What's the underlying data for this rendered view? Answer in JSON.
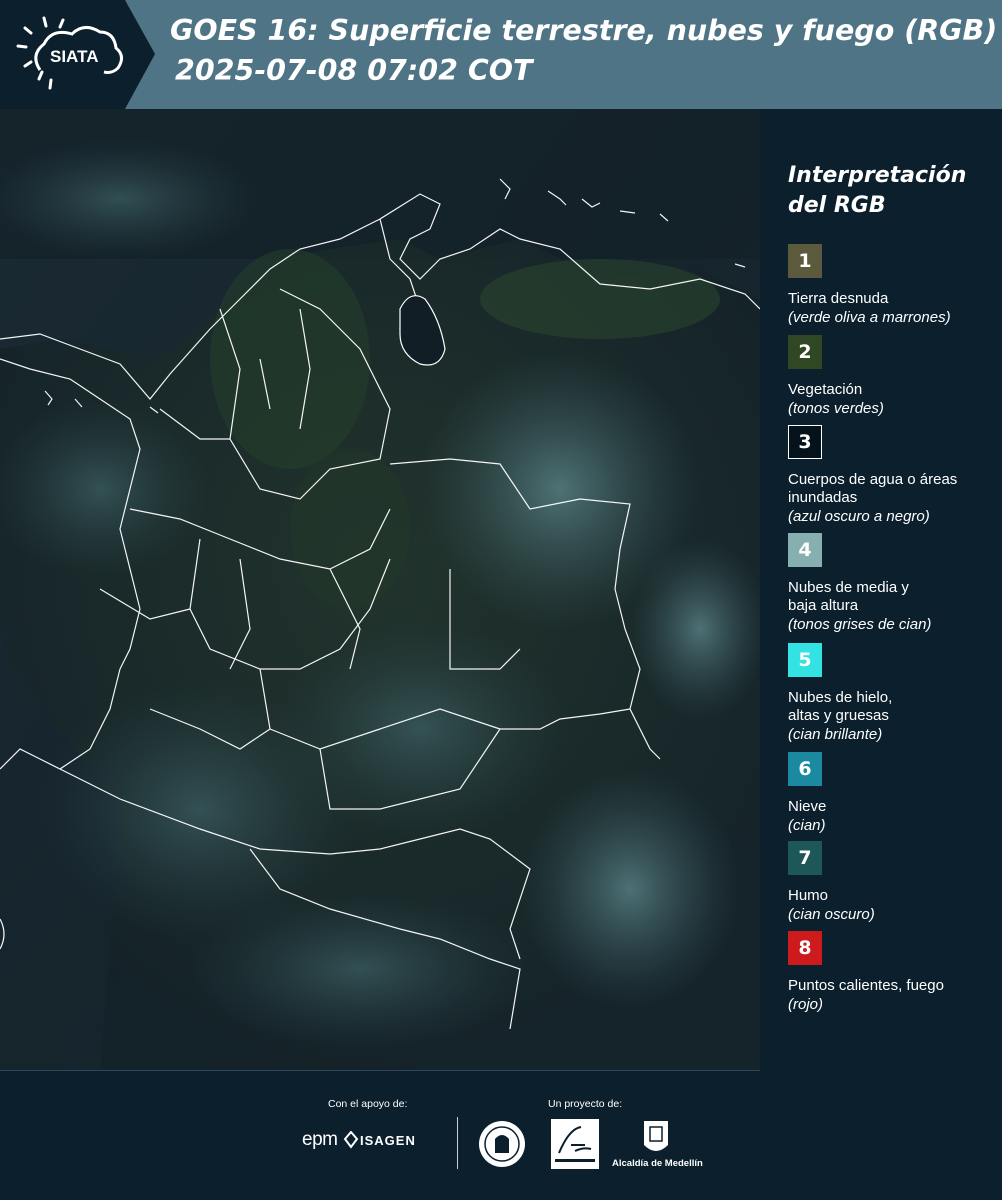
{
  "header": {
    "title_line1": "GOES 16: Superficie terrestre, nubes y fuego (RGB)",
    "title_line2": "2025-07-08 07:02 COT",
    "logo_text": "SIATA",
    "color": "#4f7485"
  },
  "legend": {
    "title_line1": "Interpretación",
    "title_line2": "del RGB",
    "items": [
      {
        "number": "1",
        "color": "#5b5a3c",
        "label": "Tierra desnuda",
        "sub": "(verde oliva a marrones)"
      },
      {
        "number": "2",
        "color": "#2f4722",
        "label": "Vegetación",
        "sub": "(tonos verdes)"
      },
      {
        "number": "3",
        "color": "#04121c",
        "label": "Cuerpos de agua o áreas inundadas",
        "sub": "(azul oscuro a negro)"
      },
      {
        "number": "4",
        "color": "#86b0b0",
        "label": "Nubes de media y baja altura",
        "sub": "(tonos grises de cian)"
      },
      {
        "number": "5",
        "color": "#33e2e2",
        "label": "Nubes de hielo, altas y gruesas",
        "sub": "(cian brillante)"
      },
      {
        "number": "6",
        "color": "#1b8aa0",
        "label": "Nieve",
        "sub": "(cian)"
      },
      {
        "number": "7",
        "color": "#1d5758",
        "label": "Humo",
        "sub": "(cian oscuro)"
      },
      {
        "number": "8",
        "color": "#cc1a1d",
        "label": "Puntos calientes, fuego",
        "sub": "(rojo)"
      }
    ]
  },
  "footer": {
    "support_label": "Con el apoyo de:",
    "project_label": "Un proyecto de:",
    "sponsors": [
      "epm",
      "ISAGEN"
    ],
    "partners": [
      "Área Metropolitana",
      "Alcaldía de Medellín"
    ],
    "medellin_label": "Alcaldía de Medellín"
  }
}
